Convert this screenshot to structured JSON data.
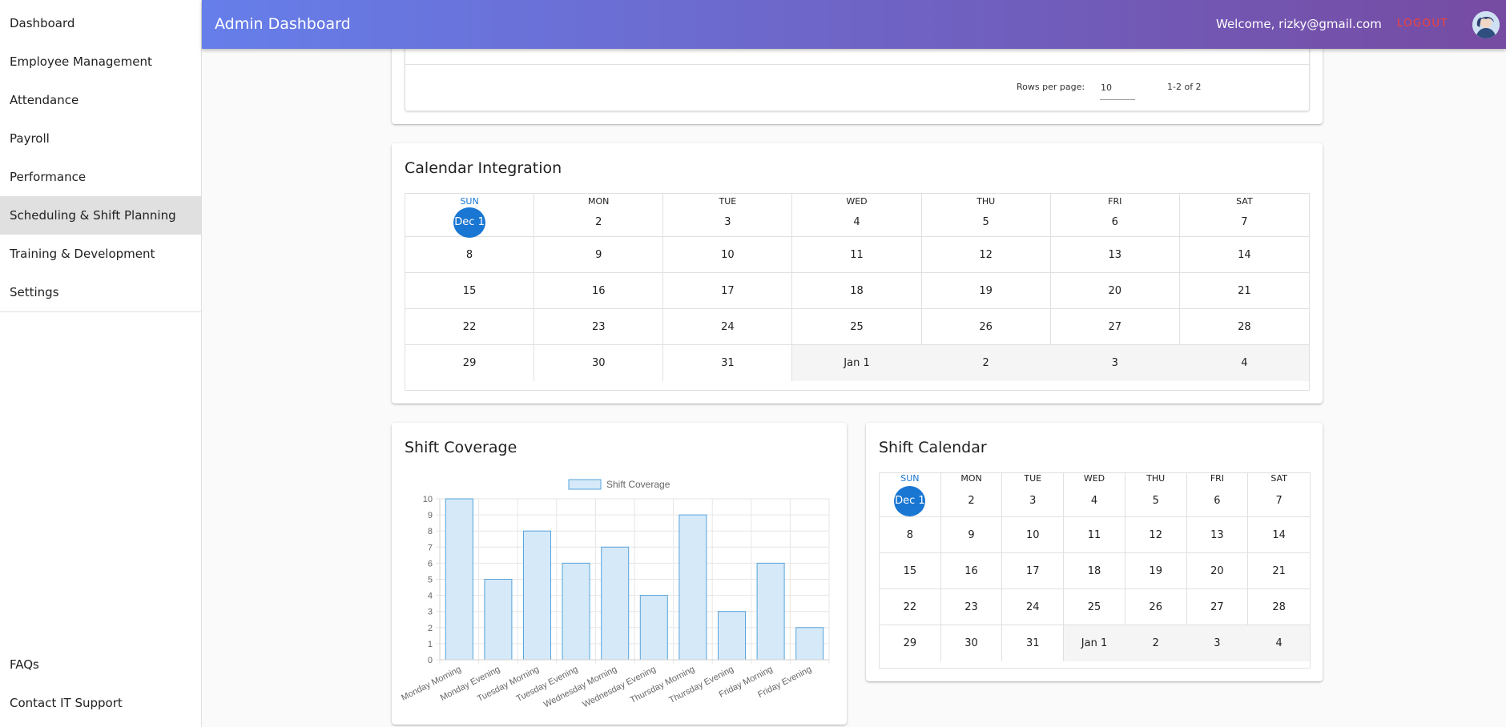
{
  "sidebar": {
    "items": [
      {
        "label": "Dashboard",
        "name": "sidebar-item-dashboard"
      },
      {
        "label": "Employee Management",
        "name": "sidebar-item-employee-management"
      },
      {
        "label": "Attendance",
        "name": "sidebar-item-attendance"
      },
      {
        "label": "Payroll",
        "name": "sidebar-item-payroll"
      },
      {
        "label": "Performance",
        "name": "sidebar-item-performance"
      },
      {
        "label": "Scheduling & Shift Planning",
        "name": "sidebar-item-scheduling",
        "active": true
      },
      {
        "label": "Training & Development",
        "name": "sidebar-item-training"
      },
      {
        "label": "Settings",
        "name": "sidebar-item-settings"
      }
    ],
    "bottom": [
      {
        "label": "FAQs",
        "name": "sidebar-item-faqs"
      },
      {
        "label": "Contact IT Support",
        "name": "sidebar-item-contact-it-support"
      }
    ]
  },
  "header": {
    "title": "Admin Dashboard",
    "welcome": "Welcome, rizky@gmail.com",
    "logout": "LOGOUT",
    "avatar_icon": "user-avatar-icon",
    "gradient": [
      "#667eea",
      "#764ba2"
    ]
  },
  "pagination": {
    "rows_label": "Rows per page:",
    "rows_value": "10",
    "range": "1-2 of 2"
  },
  "calendar_integration": {
    "title": "Calendar Integration",
    "weekdays": [
      "SUN",
      "MON",
      "TUE",
      "WED",
      "THU",
      "FRI",
      "SAT"
    ],
    "weeks": [
      [
        "Dec 1",
        "2",
        "3",
        "4",
        "5",
        "6",
        "7"
      ],
      [
        "8",
        "9",
        "10",
        "11",
        "12",
        "13",
        "14"
      ],
      [
        "15",
        "16",
        "17",
        "18",
        "19",
        "20",
        "21"
      ],
      [
        "22",
        "23",
        "24",
        "25",
        "26",
        "27",
        "28"
      ],
      [
        "29",
        "30",
        "31",
        "Jan 1",
        "2",
        "3",
        "4"
      ]
    ],
    "today": "Dec 1",
    "accent": "#1976d2"
  },
  "shift_coverage": {
    "title": "Shift Coverage"
  },
  "chart_data": {
    "type": "bar",
    "categories": [
      "Monday Morning",
      "Monday Evening",
      "Tuesday Morning",
      "Tuesday Evening",
      "Wednesday Morning",
      "Wednesday Evening",
      "Thursday Morning",
      "Thursday Evening",
      "Friday Morning",
      "Friday Evening"
    ],
    "series": [
      {
        "name": "Shift Coverage",
        "values": [
          10,
          5,
          8,
          6,
          7,
          4,
          9,
          3,
          6,
          2
        ]
      }
    ],
    "yticks": [
      "0",
      "1",
      "2",
      "3",
      "4",
      "5",
      "6",
      "7",
      "8",
      "9",
      "10"
    ],
    "ylim": [
      0,
      10
    ],
    "grid": true,
    "legend": "top",
    "bar_fill": "#d6e9f8",
    "bar_stroke": "#56a3dc"
  },
  "shift_calendar": {
    "title": "Shift Calendar",
    "weekdays": [
      "SUN",
      "MON",
      "TUE",
      "WED",
      "THU",
      "FRI",
      "SAT"
    ],
    "weeks": [
      [
        "Dec 1",
        "2",
        "3",
        "4",
        "5",
        "6",
        "7"
      ],
      [
        "8",
        "9",
        "10",
        "11",
        "12",
        "13",
        "14"
      ],
      [
        "15",
        "16",
        "17",
        "18",
        "19",
        "20",
        "21"
      ],
      [
        "22",
        "23",
        "24",
        "25",
        "26",
        "27",
        "28"
      ],
      [
        "29",
        "30",
        "31",
        "Jan 1",
        "2",
        "3",
        "4"
      ]
    ],
    "today": "Dec 1"
  }
}
